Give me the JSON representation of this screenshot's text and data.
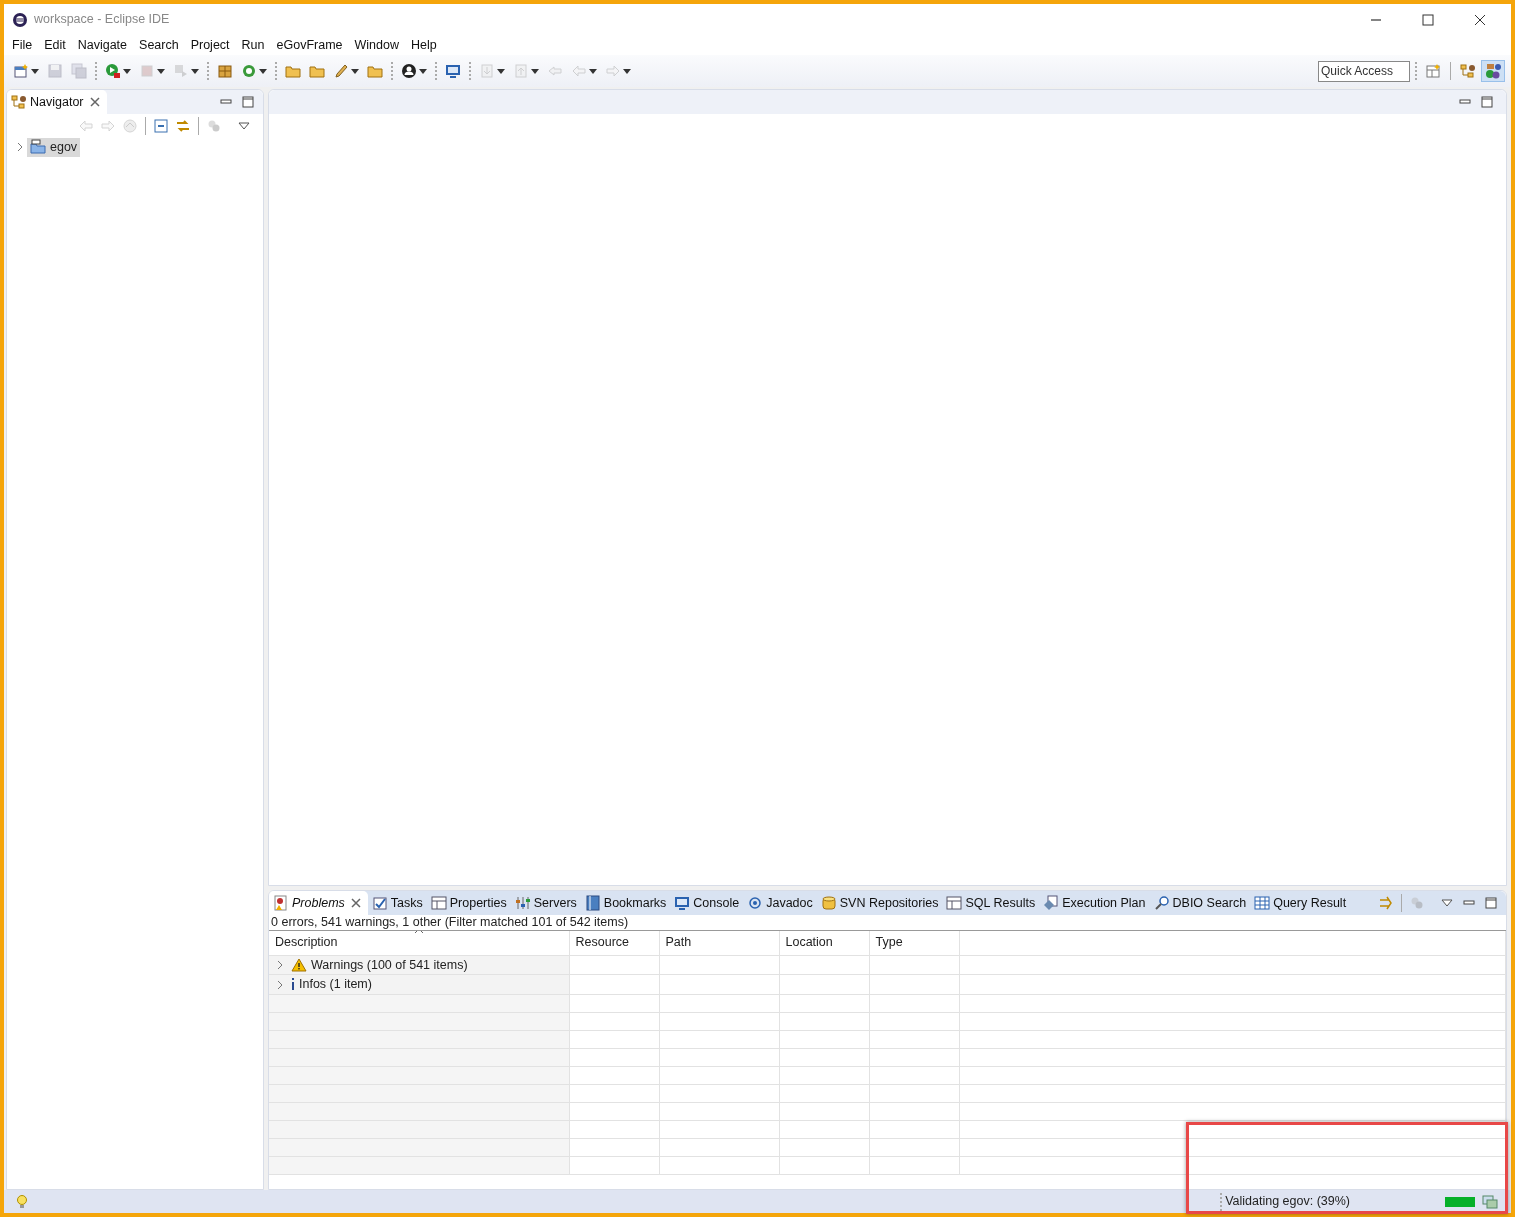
{
  "window": {
    "title": "workspace - Eclipse IDE"
  },
  "menu": [
    "File",
    "Edit",
    "Navigate",
    "Search",
    "Project",
    "Run",
    "eGovFrame",
    "Window",
    "Help"
  ],
  "toolbar": [
    {
      "kind": "new",
      "dropdown": true,
      "disabled": false
    },
    {
      "kind": "save",
      "dropdown": false,
      "disabled": true
    },
    {
      "kind": "save-all",
      "dropdown": false,
      "disabled": true
    },
    {
      "kind": "sep"
    },
    {
      "kind": "run",
      "dropdown": true,
      "disabled": false
    },
    {
      "kind": "stop",
      "dropdown": true,
      "disabled": true
    },
    {
      "kind": "skip",
      "dropdown": true,
      "disabled": true
    },
    {
      "kind": "sep"
    },
    {
      "kind": "package",
      "dropdown": false,
      "disabled": false
    },
    {
      "kind": "refresh",
      "dropdown": true,
      "disabled": false
    },
    {
      "kind": "sep"
    },
    {
      "kind": "folder",
      "dropdown": false,
      "disabled": false
    },
    {
      "kind": "folder",
      "dropdown": false,
      "disabled": false
    },
    {
      "kind": "brush",
      "dropdown": true,
      "disabled": false
    },
    {
      "kind": "folder",
      "dropdown": false,
      "disabled": false
    },
    {
      "kind": "sep"
    },
    {
      "kind": "person",
      "dropdown": true,
      "disabled": false
    },
    {
      "kind": "sep"
    },
    {
      "kind": "monitor",
      "dropdown": false,
      "disabled": false
    },
    {
      "kind": "sep"
    },
    {
      "kind": "import",
      "dropdown": true,
      "disabled": true
    },
    {
      "kind": "export",
      "dropdown": true,
      "disabled": true
    },
    {
      "kind": "back-edit",
      "dropdown": false,
      "disabled": true
    },
    {
      "kind": "back",
      "dropdown": true,
      "disabled": true
    },
    {
      "kind": "forward",
      "dropdown": true,
      "disabled": true
    }
  ],
  "quick_access": {
    "placeholder": "Quick Access"
  },
  "perspectives": [
    {
      "kind": "open",
      "selected": false
    },
    {
      "kind": "tree",
      "selected": false
    },
    {
      "kind": "egov",
      "selected": true
    }
  ],
  "navigator": {
    "title": "Navigator",
    "toolbar": [
      {
        "kind": "back",
        "disabled": true
      },
      {
        "kind": "forward",
        "disabled": true
      },
      {
        "kind": "home",
        "disabled": true
      },
      {
        "kind": "sep"
      },
      {
        "kind": "collapse",
        "disabled": false
      },
      {
        "kind": "link",
        "disabled": false
      },
      {
        "kind": "sep"
      },
      {
        "kind": "filter",
        "disabled": true
      }
    ],
    "tree": [
      {
        "label": "egov",
        "expanded": false,
        "selected": true
      }
    ]
  },
  "bottom_panel": {
    "tabs": [
      {
        "label": "Problems",
        "kind": "problems",
        "selected": true
      },
      {
        "label": "Tasks",
        "kind": "tasks",
        "selected": false
      },
      {
        "label": "Properties",
        "kind": "table",
        "selected": false
      },
      {
        "label": "Servers",
        "kind": "servers",
        "selected": false
      },
      {
        "label": "Bookmarks",
        "kind": "book",
        "selected": false
      },
      {
        "label": "Console",
        "kind": "monitor",
        "selected": false
      },
      {
        "label": "Javadoc",
        "kind": "at",
        "selected": false
      },
      {
        "label": "SVN Repositories",
        "kind": "cylinder",
        "selected": false
      },
      {
        "label": "SQL Results",
        "kind": "table",
        "selected": false
      },
      {
        "label": "Execution Plan",
        "kind": "plan",
        "selected": false
      },
      {
        "label": "DBIO Search",
        "kind": "search",
        "selected": false
      },
      {
        "label": "Query Result",
        "kind": "grid",
        "selected": false
      }
    ],
    "summary": "0 errors, 541 warnings, 1 other (Filter matched 101 of 542 items)",
    "columns": [
      "Description",
      "Resource",
      "Path",
      "Location",
      "Type"
    ],
    "rows": [
      {
        "kind": "warning",
        "label": "Warnings (100 of 541 items)",
        "expanded": false
      },
      {
        "kind": "info",
        "label": "Infos (1 item)",
        "expanded": false
      }
    ]
  },
  "status_bar": {
    "task": "Validating egov: (39%)",
    "level": 1
  },
  "highlight": {
    "color": "#e84848"
  }
}
